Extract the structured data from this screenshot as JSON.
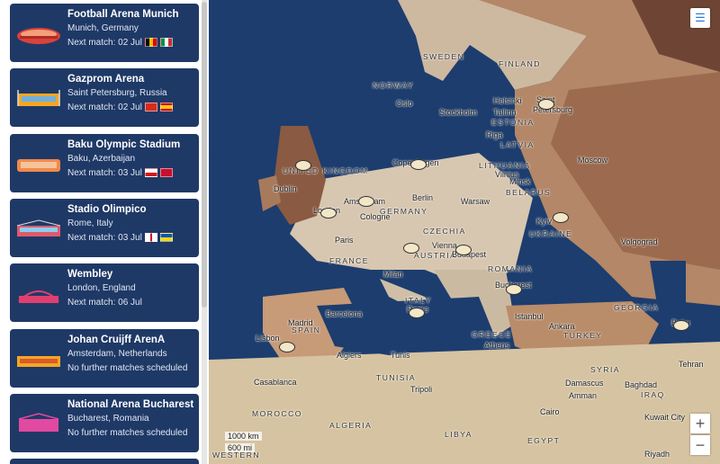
{
  "venues": [
    {
      "name": "Football Arena Munich",
      "location": "Munich, Germany",
      "status": "Next match: 02 Jul",
      "flags": [
        [
          "#000",
          "#f0c000",
          "#d00"
        ],
        [
          "#009246",
          "#fff",
          "#ce2b37"
        ]
      ]
    },
    {
      "name": "Gazprom Arena",
      "location": "Saint Petersburg, Russia",
      "status": "Next match: 02 Jul",
      "flags": [
        [
          "#d52b1e",
          "#d52b1e",
          "#d52b1e"
        ],
        [
          "#c60b1e",
          "#ffc400",
          "#c60b1e"
        ]
      ]
    },
    {
      "name": "Baku Olympic Stadium",
      "location": "Baku, Azerbaijan",
      "status": "Next match: 03 Jul",
      "flags": [
        [
          "#fff",
          "#d7141a",
          "#11457e"
        ],
        [
          "#c8102e",
          "#fff",
          "#c8102e"
        ]
      ]
    },
    {
      "name": "Stadio Olimpico",
      "location": "Rome, Italy",
      "status": "Next match: 03 Jul",
      "flags": [
        [
          "#fff",
          "#ce1124",
          "#fff"
        ],
        [
          "#0057b7",
          "#0057b7",
          "#ffd700"
        ]
      ]
    },
    {
      "name": "Wembley",
      "location": "London, England",
      "status": "Next match: 06 Jul",
      "flags": []
    },
    {
      "name": "Johan Cruijff ArenA",
      "location": "Amsterdam, Netherlands",
      "status": "No further matches scheduled",
      "flags": []
    },
    {
      "name": "National Arena Bucharest",
      "location": "Bucharest, Romania",
      "status": "No further matches scheduled",
      "flags": []
    }
  ],
  "map": {
    "scale_km": "1000 km",
    "scale_mi": "600 mi",
    "labels": {
      "sweden": "SWEDEN",
      "finland": "FINLAND",
      "norway": "NORWAY",
      "oslo": "Oslo",
      "stockholm": "Stockholm",
      "helsinki": "Helsinki",
      "tallinn": "Tallinn",
      "saint": "Saint",
      "petersburg": "Petersburg",
      "estonia": "ESTONIA",
      "latvia": "LATVIA",
      "riga": "Riga",
      "moscow": "Moscow",
      "copenhagen": "Copenhagen",
      "lithuania": "LITHUANIA",
      "vilnius": "Vilnius",
      "minsk": "Minsk",
      "belarus": "BELARUS",
      "uk": "UNITED KINGDOM",
      "dublin": "Dublin",
      "london": "London",
      "amsterdam": "Amsterdam",
      "berlin": "Berlin",
      "warsaw": "Warsaw",
      "germany": "GERMANY",
      "cologne": "Cologne",
      "czechia": "CZECHIA",
      "kyiv": "Kyiv",
      "ukraine": "UKRAINE",
      "paris": "Paris",
      "vienna": "Vienna",
      "austria": "AUSTRIA",
      "budapest": "Budapest",
      "volgograd": "Volgograd",
      "france": "FRANCE",
      "romania": "ROMANIA",
      "milan": "Milan",
      "bucharest": "Bucharest",
      "italy": "ITALY",
      "rome": "Rome",
      "georgia": "GEORGIA",
      "madrid": "Madrid",
      "spain": "SPAIN",
      "barcelona": "Barcelona",
      "istanbul": "Istanbul",
      "baku": "Baku",
      "ankara": "Ankara",
      "turkey": "TURKEY",
      "lisbon": "Lisbon",
      "greece": "GREECE",
      "athens": "Athens",
      "algiers": "Algiers",
      "tunis": "Tunis",
      "tehran": "Tehran",
      "syria": "SYRIA",
      "casablanca": "Casablanca",
      "tunisia": "TUNISIA",
      "tripoli": "Tripoli",
      "damascus": "Damascus",
      "amman": "Amman",
      "baghdad": "Baghdad",
      "iraq": "IRAQ",
      "morocco": "MOROCCO",
      "algeria": "ALGERIA",
      "libya": "LIBYA",
      "cairo": "Cairo",
      "kuwait": "Kuwait City",
      "egypt": "EGYPT",
      "western": "WESTERN",
      "riyadh": "Riyadh"
    }
  }
}
